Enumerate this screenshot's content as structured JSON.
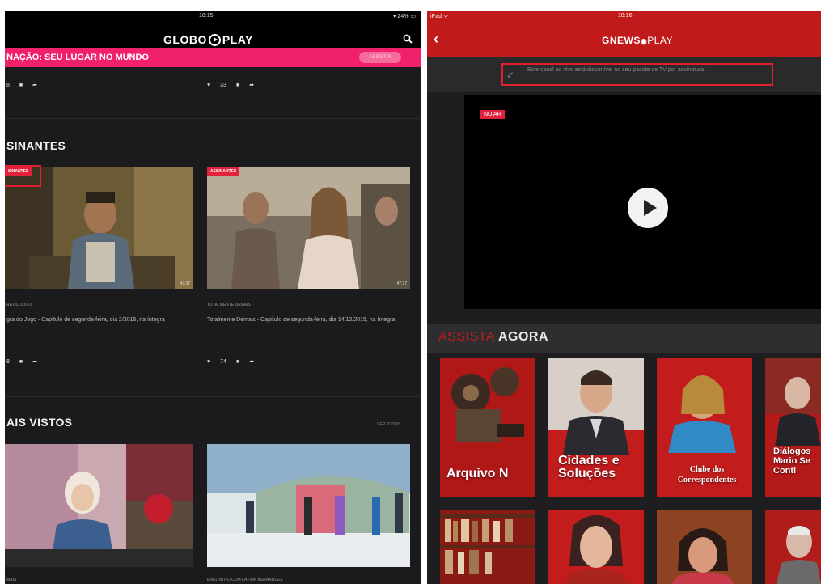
{
  "left_app": {
    "status_time": "18:15",
    "status_battery": "▾ 24% ▭",
    "logo": {
      "text_a": "GLOBO",
      "text_b": "PLAY"
    },
    "banner": {
      "text": "NAÇÃO: SEU LUGAR NO MUNDO",
      "button": "ASSISTIR"
    },
    "top_row": {
      "left_count": "8",
      "right_count": "33"
    },
    "section_assinantes": {
      "title": "SINANTES",
      "items": [
        {
          "tag": "SINANTES",
          "duration": "47:37",
          "program": "RA DO JOGO",
          "description": "gra do Jogo - Capítulo de segunda-feira, dia 2/2015, na íntegra",
          "likes": "8"
        },
        {
          "tag": "ASSINANTES",
          "duration": "47:37",
          "program": "TOTALMENTE DEMAIS",
          "description": "Totalmente Demais - Capítulo de segunda-feira, dia 14/12/2015, na íntegra",
          "likes": "74"
        }
      ]
    },
    "section_vistos": {
      "title": "AIS VISTOS",
      "see_all": "VER TODOS",
      "items": [
        {
          "program": "MAIS"
        },
        {
          "program": "ENCONTRO COM FÁTIMA BERNARDES"
        }
      ]
    }
  },
  "right_app": {
    "status_device": "iPad ᯤ",
    "status_time": "18:16",
    "logo": {
      "text_a": "GNEWS",
      "text_b": "PLAY"
    },
    "back_symbol": "‹",
    "info_text": "Este canal ao vivo está disponível no seu pacote de TV por assinatura.",
    "live_badge": "NO AR",
    "section_title": {
      "part_a": "ASSISTA ",
      "part_b": "AGORA"
    },
    "cards": [
      {
        "label": "Arquivo N"
      },
      {
        "label": "Cidades e Soluções"
      },
      {
        "label": "Clube dos Correspondentes"
      },
      {
        "label": "Diálogos Mario Se Conti"
      }
    ]
  },
  "colors": {
    "globoplay_pink": "#f0206a",
    "globonews_red": "#c01a1a",
    "tag_red": "#e1223c",
    "highlight_box": "#e02030"
  }
}
